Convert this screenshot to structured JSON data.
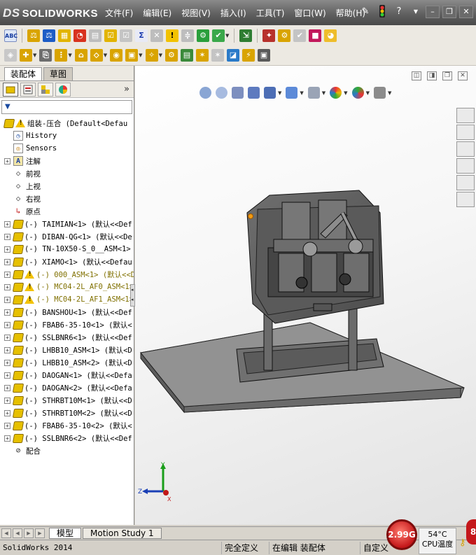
{
  "app": {
    "logo": "SOLIDWORKS",
    "logo_prefix": "DS",
    "menu": [
      "文件(F)",
      "编辑(E)",
      "视图(V)",
      "插入(I)",
      "工具(T)",
      "窗口(W)",
      "帮助(H)"
    ]
  },
  "left_panel": {
    "tabs": [
      "装配体",
      "草图"
    ],
    "active_tab": "装配体",
    "tree": [
      {
        "label": "组装-压合  (Default<Defau",
        "icon": "assembly",
        "warn": true,
        "expand": false,
        "indent": 0
      },
      {
        "label": "History",
        "icon": "history",
        "warn": false,
        "expand": false,
        "indent": 1
      },
      {
        "label": "Sensors",
        "icon": "sensor",
        "warn": false,
        "expand": false,
        "indent": 1
      },
      {
        "label": "注解",
        "icon": "annotation",
        "warn": false,
        "expand": true,
        "indent": 1
      },
      {
        "label": "前视",
        "icon": "plane",
        "warn": false,
        "expand": false,
        "indent": 1
      },
      {
        "label": "上视",
        "icon": "plane",
        "warn": false,
        "expand": false,
        "indent": 1
      },
      {
        "label": "右视",
        "icon": "plane",
        "warn": false,
        "expand": false,
        "indent": 1
      },
      {
        "label": "原点",
        "icon": "origin",
        "warn": false,
        "expand": false,
        "indent": 1
      },
      {
        "label": "(-) TAIMIAN<1> (默认<<Def",
        "icon": "part",
        "warn": false,
        "expand": true,
        "indent": 1
      },
      {
        "label": "(-) DIBAN-QG<1> (默认<<De",
        "icon": "part",
        "warn": false,
        "expand": true,
        "indent": 1
      },
      {
        "label": "(-) TN-10X50-S_0__ASM<1>",
        "icon": "part",
        "warn": false,
        "expand": true,
        "indent": 1
      },
      {
        "label": "(-) XIAMO<1> (默认<<Defau",
        "icon": "part",
        "warn": false,
        "expand": true,
        "indent": 1
      },
      {
        "label": "(-) 000_ASM<1> (默认<<D",
        "icon": "part",
        "warn": true,
        "expand": true,
        "indent": 1
      },
      {
        "label": "(-) MC04-2L_AF0_ASM<1>",
        "icon": "part",
        "warn": true,
        "expand": true,
        "indent": 1
      },
      {
        "label": "(-) MC04-2L_AF1_ASM<1>",
        "icon": "part",
        "warn": true,
        "expand": true,
        "indent": 1
      },
      {
        "label": "(-) BANSHOU<1> (默认<<Def",
        "icon": "part",
        "warn": false,
        "expand": true,
        "indent": 1
      },
      {
        "label": "(-) FBAB6-35-10<1> (默认<",
        "icon": "part",
        "warn": false,
        "expand": true,
        "indent": 1
      },
      {
        "label": "(-) SSLBNR6<1> (默认<<Def",
        "icon": "part",
        "warn": false,
        "expand": true,
        "indent": 1
      },
      {
        "label": "(-) LHBB10_ASM<1> (默认<D",
        "icon": "part",
        "warn": false,
        "expand": true,
        "indent": 1
      },
      {
        "label": "(-) LHBB10_ASM<2> (默认<D",
        "icon": "part",
        "warn": false,
        "expand": true,
        "indent": 1
      },
      {
        "label": "(-) DAOGAN<1> (默认<<Defa",
        "icon": "part",
        "warn": false,
        "expand": true,
        "indent": 1
      },
      {
        "label": "(-) DAOGAN<2> (默认<<Defa",
        "icon": "part",
        "warn": false,
        "expand": true,
        "indent": 1
      },
      {
        "label": "(-) STHRBT10M<1> (默认<<D",
        "icon": "part",
        "warn": false,
        "expand": true,
        "indent": 1
      },
      {
        "label": "(-) STHRBT10M<2> (默认<<D",
        "icon": "part",
        "warn": false,
        "expand": true,
        "indent": 1
      },
      {
        "label": "(-) FBAB6-35-10<2> (默认<",
        "icon": "part",
        "warn": false,
        "expand": true,
        "indent": 1
      },
      {
        "label": "(-) SSLBNR6<2> (默认<<Def",
        "icon": "part",
        "warn": false,
        "expand": true,
        "indent": 1
      },
      {
        "label": "配合",
        "icon": "mates",
        "warn": false,
        "expand": false,
        "indent": 1
      }
    ]
  },
  "viewport": {
    "triad": {
      "x": "X",
      "y": "Y",
      "z": "Z"
    }
  },
  "bottom_tabs": [
    "模型",
    "Motion Study 1"
  ],
  "active_bottom_tab": "模型",
  "status": {
    "app_name": "SolidWorks 2014",
    "state1": "完全定义",
    "state2": "在编辑 装配体",
    "state3": "自定义"
  },
  "gadget": {
    "cpu_value": "2.99G",
    "temp": "54°C",
    "temp_label": "CPU温度",
    "badge": "8"
  },
  "colors": {
    "title_bar": "#5e5e5e",
    "toolbar": "#ece9e2",
    "warning": "#f2c200",
    "part_icon": "#e6c000",
    "model_gray": "#8c8c8c"
  }
}
